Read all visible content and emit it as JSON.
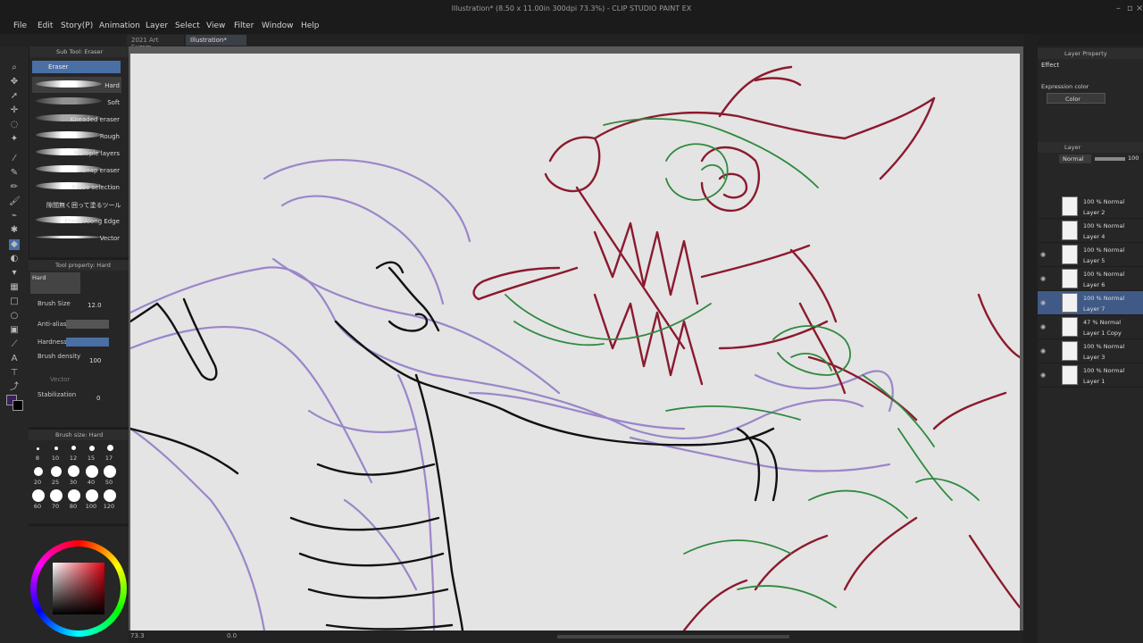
{
  "window": {
    "title": "Illustration* (8.50 x 11.00in 300dpi 73.3%) - CLIP STUDIO PAINT EX"
  },
  "menu": [
    "File",
    "Edit",
    "Story(P)",
    "Animation",
    "Layer",
    "Select",
    "View",
    "Filter",
    "Window",
    "Help"
  ],
  "tabs": [
    {
      "label": "2021 Art Summ"
    },
    {
      "label": "Illustration*"
    }
  ],
  "subtool": {
    "panel_title": "Sub Tool: Eraser",
    "group": "Eraser",
    "items": [
      "Hard",
      "Soft",
      "Kneaded eraser",
      "Rough",
      "Multiple layers",
      "Snap eraser",
      "Erase selection",
      "隙間無く囲って塗るツール",
      "Erase Along Edge",
      "Vector"
    ]
  },
  "tool_property": {
    "panel_title": "Tool property: Hard",
    "preset": "Hard",
    "brush_size_label": "Brush Size",
    "brush_size_value": "12.0",
    "anti_alias_label": "Anti-alias",
    "hardness_label": "Hardness",
    "brush_density_label": "Brush density",
    "brush_density_value": "100",
    "vector_label": "Vector",
    "stabilization_label": "Stabilization",
    "stabilization_value": "0"
  },
  "brush_size": {
    "panel_title": "Brush size: Hard",
    "sizes": [
      "8",
      "10",
      "12",
      "15",
      "17",
      "20",
      "25",
      "30",
      "40",
      "50",
      "60",
      "70",
      "80",
      "100",
      "120"
    ]
  },
  "colors": {
    "main": "#3b1f5c",
    "sub": "#000000",
    "accent": "#4a6fa5"
  },
  "status": {
    "zoom": "73.3",
    "angle": "0.0"
  },
  "layer_property": {
    "panel_title": "Layer Property",
    "effect_label": "Effect",
    "expression_color_label": "Expression color",
    "expression_color_value": "Color"
  },
  "layers": {
    "panel_title": "Layer",
    "blend_mode": "Normal",
    "opacity": "100",
    "items": [
      {
        "mode": "100 % Normal",
        "name": "Layer 2",
        "visible": false,
        "selected": false
      },
      {
        "mode": "100 % Normal",
        "name": "Layer 4",
        "visible": false,
        "selected": false
      },
      {
        "mode": "100 % Normal",
        "name": "Layer 5",
        "visible": true,
        "selected": false
      },
      {
        "mode": "100 % Normal",
        "name": "Layer 6",
        "visible": true,
        "selected": false
      },
      {
        "mode": "100 % Normal",
        "name": "Layer 7",
        "visible": true,
        "selected": true
      },
      {
        "mode": "47 % Normal",
        "name": "Layer 1 Copy",
        "visible": true,
        "selected": false
      },
      {
        "mode": "100 % Normal",
        "name": "Layer 3",
        "visible": true,
        "selected": false
      },
      {
        "mode": "100 % Normal",
        "name": "Layer 1",
        "visible": true,
        "selected": false
      }
    ]
  }
}
